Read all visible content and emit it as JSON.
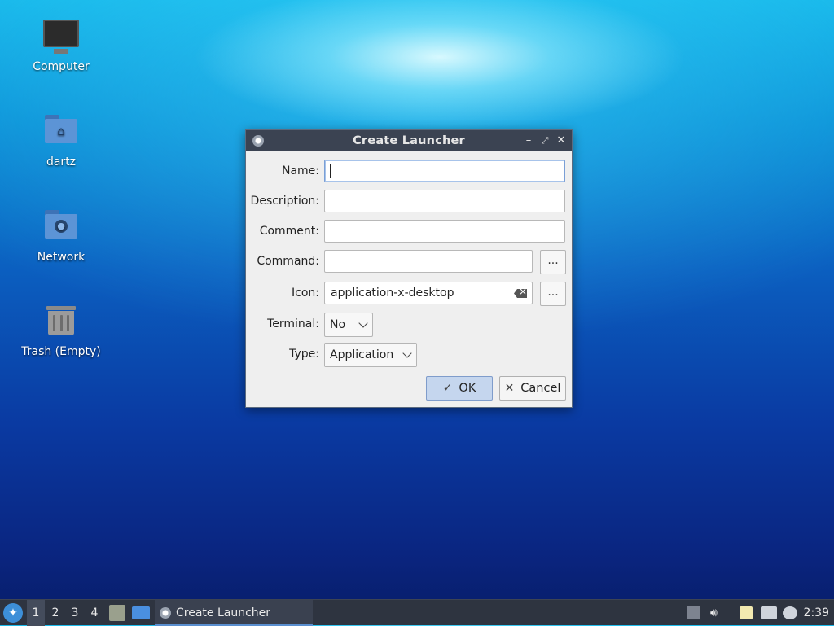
{
  "desktop": {
    "icons": [
      {
        "label": "Computer"
      },
      {
        "label": "dartz"
      },
      {
        "label": "Network"
      },
      {
        "label": "Trash (Empty)"
      }
    ]
  },
  "dialog": {
    "title": "Create Launcher",
    "fields": {
      "name": {
        "label": "Name:",
        "value": ""
      },
      "description": {
        "label": "Description:",
        "value": ""
      },
      "comment": {
        "label": "Comment:",
        "value": ""
      },
      "command": {
        "label": "Command:",
        "value": "",
        "browse_label": "..."
      },
      "icon": {
        "label": "Icon:",
        "value": "application-x-desktop",
        "browse_label": "..."
      },
      "terminal": {
        "label": "Terminal:",
        "value": "No"
      },
      "type": {
        "label": "Type:",
        "value": "Application"
      }
    },
    "buttons": {
      "ok": "OK",
      "cancel": "Cancel"
    }
  },
  "taskbar": {
    "workspaces": [
      "1",
      "2",
      "3",
      "4"
    ],
    "active_workspace": "1",
    "task_label": "Create Launcher",
    "clock": "2:39"
  },
  "colors": {
    "titlebar": "#3b4352",
    "taskbar": "#2e3440",
    "ok_button": "#c5d6ee",
    "accent": "#5a8fd0"
  }
}
